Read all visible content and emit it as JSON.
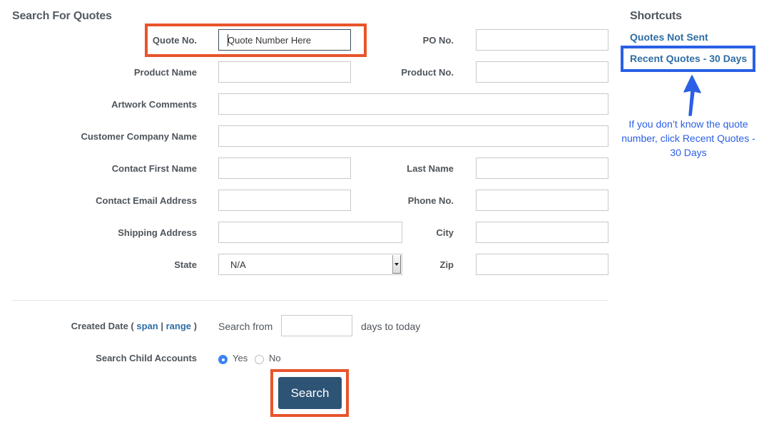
{
  "search_section": {
    "title": "Search For Quotes"
  },
  "fields": {
    "quote_no": {
      "label": "Quote No.",
      "value": "Quote Number Here"
    },
    "po_no": {
      "label": "PO No.",
      "value": ""
    },
    "product_name": {
      "label": "Product Name",
      "value": ""
    },
    "product_no": {
      "label": "Product No.",
      "value": ""
    },
    "artwork_comments": {
      "label": "Artwork Comments",
      "value": ""
    },
    "customer_company_name": {
      "label": "Customer Company Name",
      "value": ""
    },
    "contact_first_name": {
      "label": "Contact First Name",
      "value": ""
    },
    "last_name": {
      "label": "Last Name",
      "value": ""
    },
    "contact_email_address": {
      "label": "Contact Email Address",
      "value": ""
    },
    "phone_no": {
      "label": "Phone No.",
      "value": ""
    },
    "shipping_address": {
      "label": "Shipping Address",
      "value": ""
    },
    "city": {
      "label": "City",
      "value": ""
    },
    "state": {
      "label": "State",
      "selected": "N/A"
    },
    "zip": {
      "label": "Zip",
      "value": ""
    }
  },
  "created_date": {
    "label_prefix": "Created Date (",
    "span_link": "span",
    "separator": "|",
    "range_link": "range",
    "label_suffix": ")",
    "search_from": "Search from",
    "days_value": "",
    "days_to_today": "days to today"
  },
  "child_accounts": {
    "label": "Search Child Accounts",
    "yes_label": "Yes",
    "no_label": "No",
    "selected": "Yes"
  },
  "search_button": {
    "label": "Search"
  },
  "shortcuts": {
    "title": "Shortcuts",
    "items": [
      {
        "label": "Quotes Not Sent"
      },
      {
        "label": "Recent Quotes - 30 Days"
      }
    ]
  },
  "annotation": {
    "text": "If you don’t know the quote number, click Recent Quotes - 30 Days"
  },
  "colors": {
    "highlight_orange": "#e8542a",
    "highlight_blue": "#2a5fe6",
    "button_bg": "#2d5475",
    "link": "#2e6da4",
    "radio_checked": "#3b82f6"
  }
}
